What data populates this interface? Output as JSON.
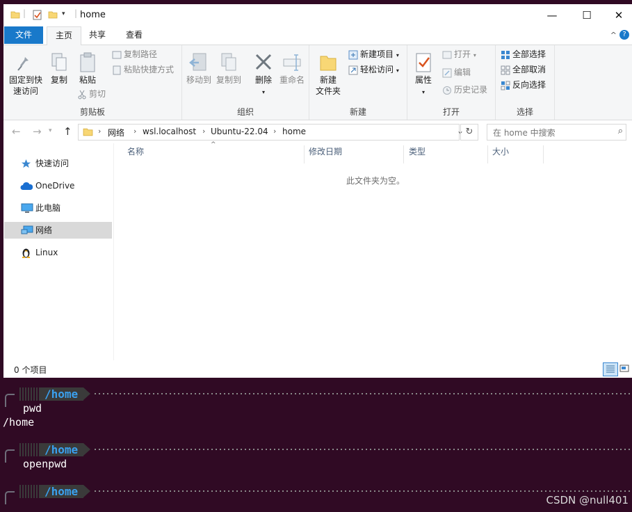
{
  "window": {
    "title": "home",
    "minimize": "—",
    "maximize": "☐",
    "close": "✕"
  },
  "ribbon_tabs": {
    "file": "文件",
    "home": "主页",
    "share": "共享",
    "view": "查看",
    "collapse": "^",
    "help": "?"
  },
  "clipboard": {
    "pin": "固定到快\n速访问",
    "pin_line1": "固定到快",
    "pin_line2": "速访问",
    "copy": "复制",
    "paste": "粘贴",
    "copy_path": "复制路径",
    "paste_shortcut": "粘贴快捷方式",
    "cut": "剪切",
    "label": "剪贴板"
  },
  "organize": {
    "move_to": "移动到",
    "copy_to": "复制到",
    "delete": "删除",
    "rename": "重命名",
    "label": "组织"
  },
  "new_group": {
    "new_folder_line1": "新建",
    "new_folder_line2": "文件夹",
    "new_item": "新建项目",
    "easy_access": "轻松访问",
    "label": "新建"
  },
  "open_group": {
    "properties": "属性",
    "open": "打开",
    "edit": "编辑",
    "history": "历史记录",
    "label": "打开"
  },
  "select_group": {
    "select_all": "全部选择",
    "select_none": "全部取消",
    "invert": "反向选择",
    "label": "选择"
  },
  "breadcrumb": [
    "网络",
    "wsl.localhost",
    "Ubuntu-22.04",
    "home"
  ],
  "search": {
    "placeholder": "在 home 中搜索"
  },
  "sidebar": {
    "items": [
      {
        "label": "快速访问",
        "icon": "star-icon"
      },
      {
        "label": "OneDrive",
        "icon": "cloud-icon"
      },
      {
        "label": "此电脑",
        "icon": "computer-icon"
      },
      {
        "label": "网络",
        "icon": "network-icon",
        "selected": true
      },
      {
        "label": "Linux",
        "icon": "penguin-icon"
      }
    ]
  },
  "columns": {
    "name": "名称",
    "date": "修改日期",
    "type": "类型",
    "size": "大小"
  },
  "empty_message": "此文件夹为空。",
  "status": {
    "count": "0 个项目"
  },
  "terminal": {
    "prompt_path": "/home",
    "lines": [
      {
        "cmd": "pwd",
        "output": "/home"
      },
      {
        "cmd": "openpwd",
        "output": ""
      },
      {
        "cmd": "",
        "output": ""
      }
    ]
  },
  "watermark": "CSDN @null401",
  "colors": {
    "accent": "#1979ca",
    "terminal_bg": "#300a24",
    "prompt_blue": "#3aa0ee"
  }
}
